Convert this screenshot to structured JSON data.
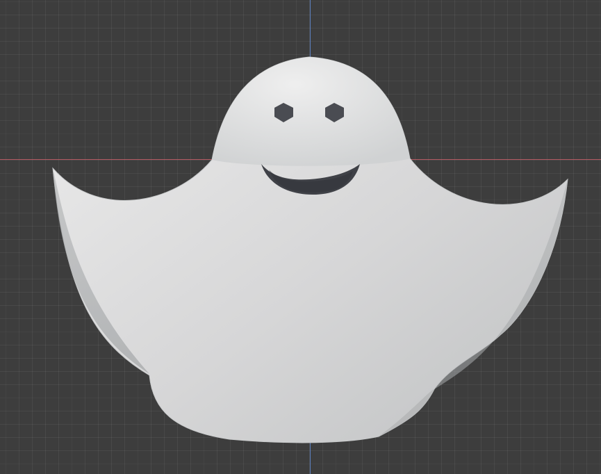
{
  "viewport": {
    "background_color": "#3d3d3d",
    "grid": true,
    "x_axis_color": "#b45a62",
    "y_axis_color": "#5c7fbd"
  },
  "model": {
    "object_icon": "ghost-icon",
    "body_color": "#d7d7d8",
    "shadow_color": "#aeb0b1",
    "face_color": "#4a4c52"
  }
}
